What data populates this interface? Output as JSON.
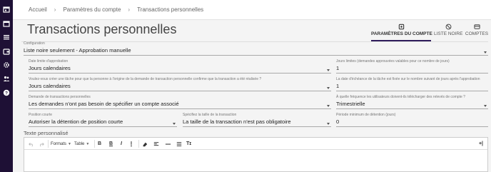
{
  "colors": {
    "sidebar": "#1e1035",
    "accent": "#2e1b5a"
  },
  "sidebar": {
    "icons": [
      "calendar-icon",
      "list-icon",
      "wallet-icon",
      "gear-icon",
      "people-icon",
      "help-icon"
    ]
  },
  "breadcrumb": {
    "items": [
      "Accueil",
      "Paramètres du compte",
      "Transactions personnelles"
    ],
    "separator": "›"
  },
  "page": {
    "title": "Transactions personnelles"
  },
  "tabs": [
    {
      "label": "PARAMÈTRES DU COMPTE",
      "icon": "settings-icon",
      "active": true
    },
    {
      "label": "LISTE NOIRE",
      "icon": "block-icon",
      "active": false
    },
    {
      "label": "COMPTES",
      "icon": "accounts-icon",
      "active": false
    }
  ],
  "form": {
    "configuration": {
      "label": "Configuration",
      "value": "Liste noire seulement - Approbation manuelle"
    },
    "date_limit": {
      "label": "Date limite d'approbation",
      "value": "Jours calendaires"
    },
    "limit_days": {
      "label": "Jours limites (demandes approuvées valables pour ce nombre de jours)",
      "value": "1"
    },
    "confirm_task": {
      "label": "Voulez-vous créer une tâche pour que la personne à l'origine de la demande de transaction personnelle confirme que la transaction a été réalisée ?",
      "value": "Jours calendaires"
    },
    "task_due": {
      "label": "La date d'échéance de la tâche est fixée sur le nombre suivant de jours après l'approbation",
      "value": "1"
    },
    "request_type": {
      "label": "Demande de transactions personnelles",
      "value": "Les demandes n'ont pas besoin de spécifier un compte associé"
    },
    "statement_freq": {
      "label": "À quelle fréquence les utilisateurs doivent-ils télécharger des relevés de compte ?",
      "value": "Trimestrielle"
    },
    "short_position": {
      "label": "Position courte",
      "value": "Autoriser la détention de position courte"
    },
    "size_spec": {
      "label": "Spécifiez la taille de la transaction",
      "value": "La taille de la transaction n'est pas obligatoire"
    },
    "holding_period": {
      "label": "Période minimum de détention (jours)",
      "value": "0"
    }
  },
  "editor": {
    "label": "Texte personnalisé",
    "toolbar": {
      "undo_icon": "undo-icon",
      "redo_icon": "redo-icon",
      "formats_label": "Formats",
      "table_label": "Table",
      "bold_label": "B",
      "italic_label": "I",
      "underline_label": "I",
      "strike_label": "S",
      "eraser_icon": "eraser-icon",
      "align_left_icon": "align-left-icon",
      "hr_icon": "horizontal-rule-icon",
      "list_icon": "list-icon",
      "text_format_label": "Tɪ",
      "add_label": "+|"
    }
  }
}
